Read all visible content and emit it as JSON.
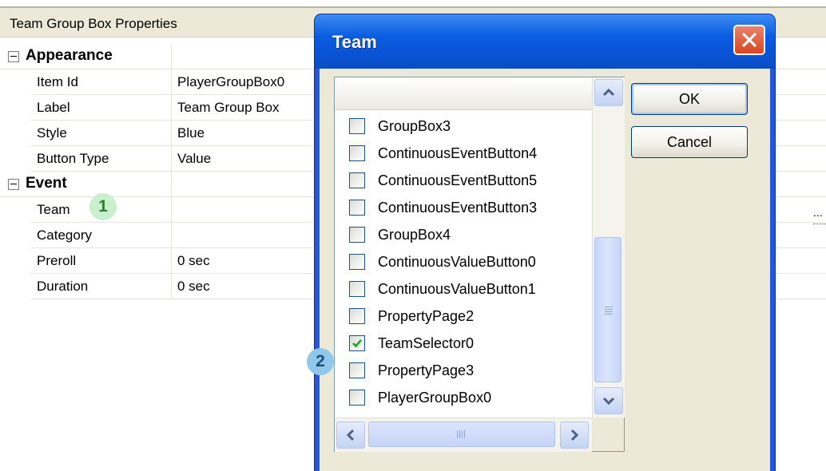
{
  "property_grid": {
    "header_title": "Team Group Box Properties",
    "categories": [
      {
        "label": "Appearance",
        "properties": [
          {
            "name": "Item Id",
            "value": "PlayerGroupBox0"
          },
          {
            "name": "Label",
            "value": "Team Group Box"
          },
          {
            "name": "Style",
            "value": "Blue"
          },
          {
            "name": "Button Type",
            "value": "Value"
          }
        ]
      },
      {
        "label": "Event",
        "properties": [
          {
            "name": "Team",
            "value": ""
          },
          {
            "name": "Category",
            "value": ""
          },
          {
            "name": "Preroll",
            "value": "0 sec"
          },
          {
            "name": "Duration",
            "value": "0 sec"
          }
        ]
      }
    ],
    "ellipsis_label": "..."
  },
  "callouts": {
    "one": "1",
    "two": "2"
  },
  "dialog": {
    "title": "Team",
    "ok_label": "OK",
    "cancel_label": "Cancel",
    "items": [
      {
        "label": "GroupBox3",
        "checked": false
      },
      {
        "label": "ContinuousEventButton4",
        "checked": false
      },
      {
        "label": "ContinuousEventButton5",
        "checked": false
      },
      {
        "label": "ContinuousEventButton3",
        "checked": false
      },
      {
        "label": "GroupBox4",
        "checked": false
      },
      {
        "label": "ContinuousValueButton0",
        "checked": false
      },
      {
        "label": "ContinuousValueButton1",
        "checked": false
      },
      {
        "label": "PropertyPage2",
        "checked": false
      },
      {
        "label": "TeamSelector0",
        "checked": true
      },
      {
        "label": "PropertyPage3",
        "checked": false
      },
      {
        "label": "PlayerGroupBox0",
        "checked": false
      }
    ]
  },
  "colors": {
    "check": "#21a121",
    "title_bar": "#0a5de0",
    "close_button": "#d8461f"
  }
}
